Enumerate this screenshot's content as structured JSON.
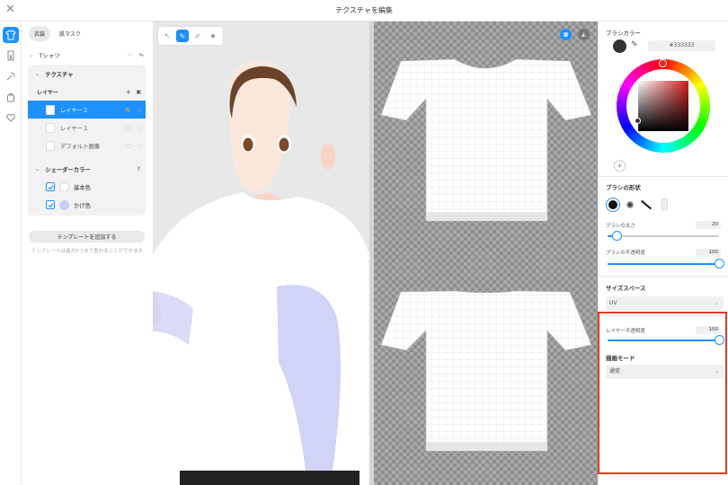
{
  "window": {
    "title": "テクスチャを編集",
    "close_icon": "close-icon"
  },
  "sidebar_icons": [
    "tshirt-icon",
    "pants-icon",
    "accessory-icon",
    "bag-icon",
    "heart-icon"
  ],
  "left": {
    "tabs": [
      {
        "label": "衣装",
        "active": true
      },
      {
        "label": "肌マスク",
        "active": false
      }
    ],
    "item_name": "Tシャツ",
    "texture_label": "テクスチャ",
    "layer_header": "レイヤー",
    "layers": [
      {
        "name": "レイヤー２",
        "selected": true
      },
      {
        "name": "レイヤー１",
        "selected": false
      },
      {
        "name": "デフォルト画像",
        "selected": false
      }
    ],
    "shader_label": "シェーダーカラー",
    "shaders": [
      {
        "name": "基本色",
        "color": "#ffffff"
      },
      {
        "name": "かげ色",
        "color": "#c9ccf4"
      }
    ],
    "add_template_label": "テンプレートを追加する",
    "template_hint": "テンプレートは最大5つまで重ねることができます"
  },
  "right": {
    "brush_color_label": "ブラシカラー",
    "brush_color_hex": "#333333",
    "color_wheel_hue": "#d21e1e",
    "brush_shape_label": "ブラシの形状",
    "brush_size_label": "ブラシの太さ",
    "brush_size_value": "20",
    "brush_size_fraction": 0.08,
    "brush_opacity_label": "ブラシの不透明度",
    "brush_opacity_value": "100",
    "brush_opacity_fraction": 1.0,
    "size_space_label": "サイズスペース",
    "size_space_value": "UV",
    "layer_opacity_label": "レイヤー不透明度",
    "layer_opacity_value": "100",
    "layer_opacity_fraction": 1.0,
    "blend_mode_label": "描画モード",
    "blend_mode_value": "通常"
  },
  "colors": {
    "accent": "#1e90ff",
    "highlight": "#e03c20"
  }
}
